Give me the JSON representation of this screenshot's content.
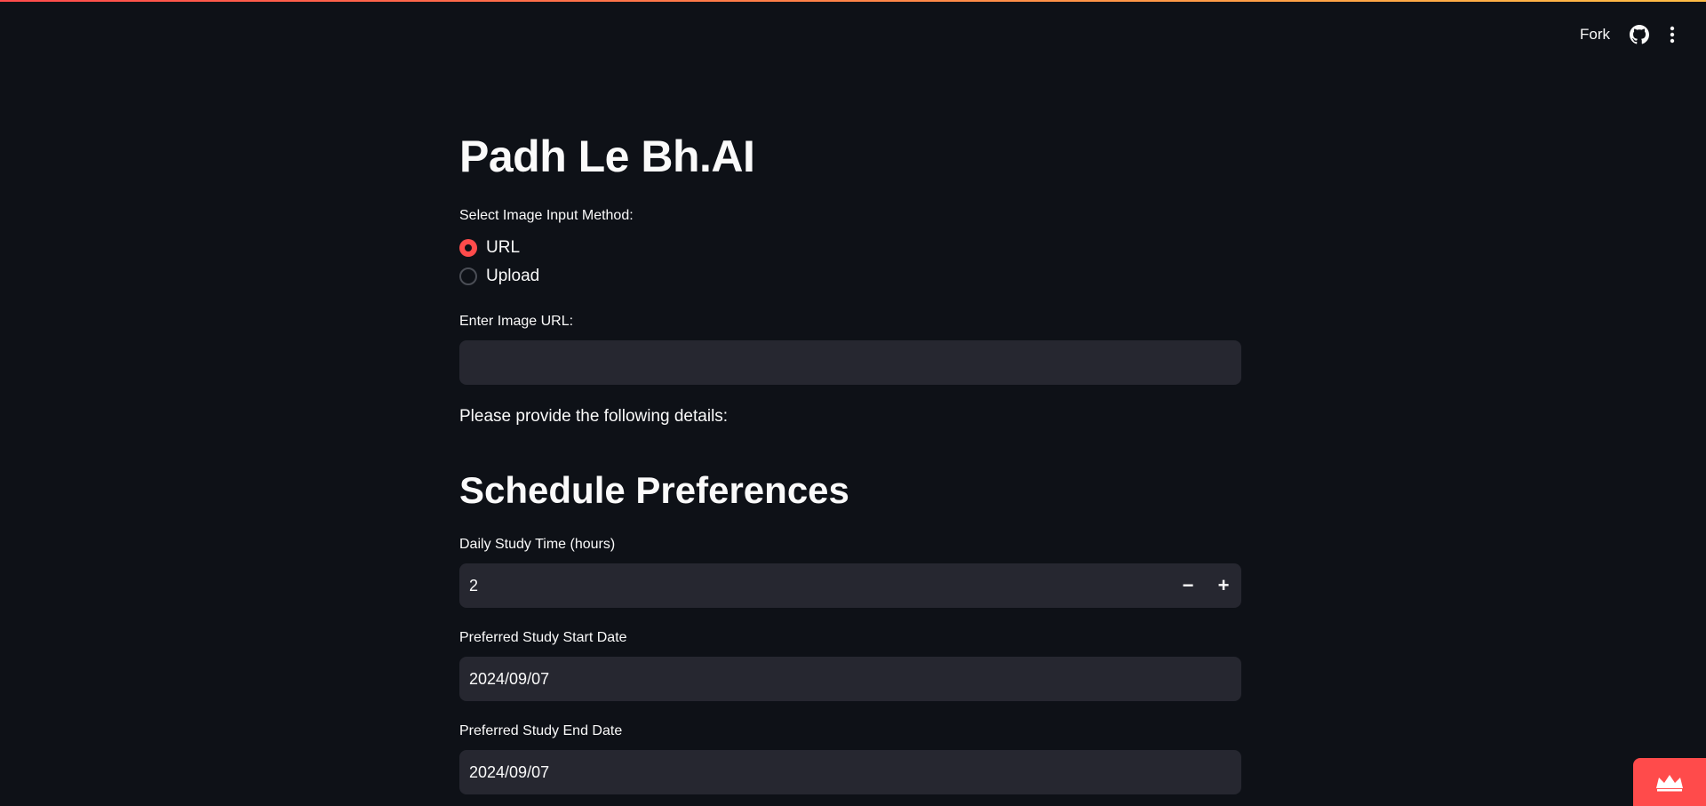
{
  "header": {
    "fork_label": "Fork",
    "github_icon": "github-icon",
    "menu_icon": "kebab-menu-icon"
  },
  "main": {
    "title": "Padh Le Bh.AI",
    "input_method": {
      "label": "Select Image Input Method:",
      "options": [
        "URL",
        "Upload"
      ],
      "selected": "URL"
    },
    "image_url": {
      "label": "Enter Image URL:",
      "value": "",
      "placeholder": ""
    },
    "details_prompt": "Please provide the following details:",
    "schedule": {
      "heading": "Schedule Preferences",
      "daily_study_time": {
        "label": "Daily Study Time (hours)",
        "value": "2",
        "decrement_label": "−",
        "increment_label": "+"
      },
      "start_date": {
        "label": "Preferred Study Start Date",
        "value": "2024/09/07"
      },
      "end_date": {
        "label": "Preferred Study End Date",
        "value": "2024/09/07"
      }
    }
  },
  "colors": {
    "background": "#0e1117",
    "field_background": "#262730",
    "accent": "#ff4b4b",
    "text": "#fafafa"
  }
}
